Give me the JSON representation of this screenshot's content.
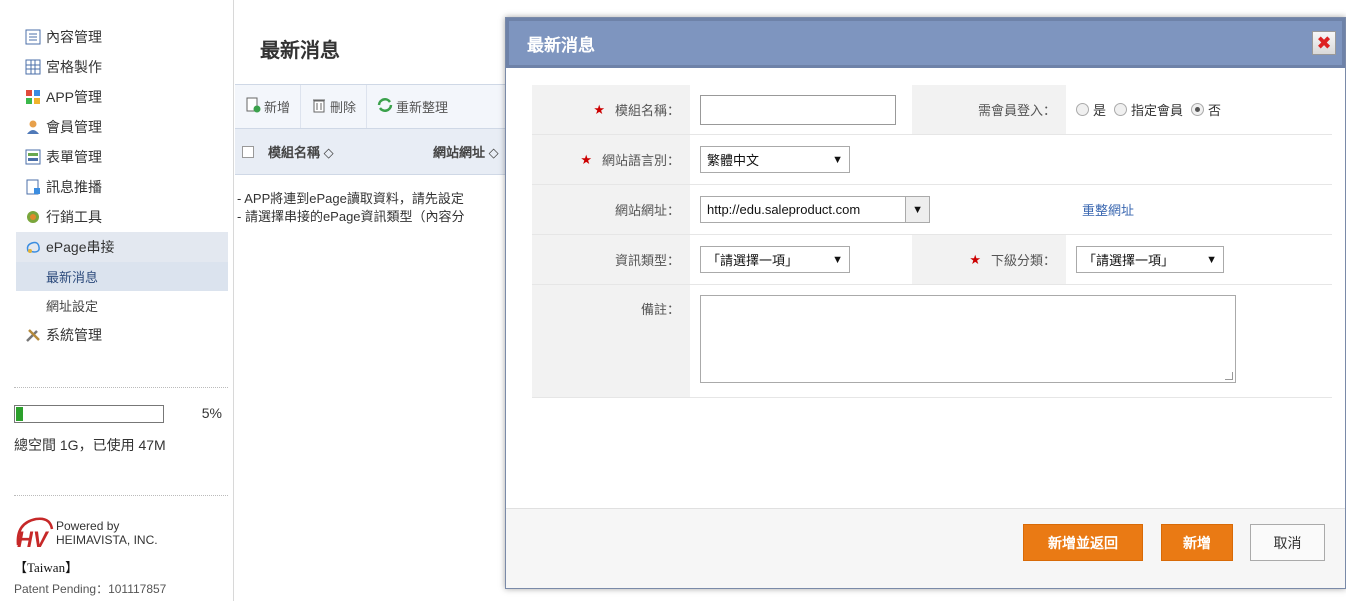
{
  "sidebar": {
    "items": [
      {
        "label": "內容管理",
        "icon": "list-icon"
      },
      {
        "label": "宮格製作",
        "icon": "grid-icon"
      },
      {
        "label": "APP管理",
        "icon": "app-icon"
      },
      {
        "label": "會員管理",
        "icon": "user-icon"
      },
      {
        "label": "表單管理",
        "icon": "form-icon"
      },
      {
        "label": "訊息推播",
        "icon": "message-icon"
      },
      {
        "label": "行銷工具",
        "icon": "marketing-icon"
      },
      {
        "label": "ePage串接",
        "icon": "epage-icon"
      },
      {
        "label": "系統管理",
        "icon": "tools-icon"
      }
    ],
    "sub_items": [
      "最新消息",
      "網址設定"
    ],
    "storage": {
      "percent": "5%",
      "used_fraction": 0.05,
      "text": "總空間 1G，已使用 47M"
    },
    "brand": {
      "line1": "Powered by",
      "line2": "HEIMAVISTA, INC.",
      "region": "【Taiwan】",
      "patent": "Patent Pending：101117857"
    }
  },
  "main": {
    "title": "最新消息",
    "toolbar": {
      "add": "新增",
      "delete": "刪除",
      "reorder": "重新整理"
    },
    "table": {
      "col1": "模組名稱 ◇",
      "col2": "網站網址 ◇"
    },
    "notes": [
      "- APP將連到ePage讀取資料，請先設定",
      "- 請選擇串接的ePage資訊類型（內容分"
    ]
  },
  "dialog": {
    "title": "最新消息",
    "close_glyph": "✖",
    "fields": {
      "module_name": {
        "label": "模組名稱：",
        "value": ""
      },
      "member_login": {
        "label": "需會員登入：",
        "options": [
          "是",
          "指定會員",
          "否"
        ],
        "selected": "否"
      },
      "language": {
        "label": "網站語言別：",
        "value": "繁體中文"
      },
      "site_url": {
        "label": "網站網址：",
        "value": "http://edu.saleproduct.com",
        "reset_link": "重整網址"
      },
      "info_type": {
        "label": "資訊類型：",
        "value": "「請選擇一項」"
      },
      "sub_category": {
        "label": "下級分類：",
        "value": "「請選擇一項」"
      },
      "remark": {
        "label": "備註：",
        "value": ""
      }
    },
    "buttons": {
      "add_return": "新增並返回",
      "add": "新增",
      "cancel": "取消"
    },
    "required_mark": "★",
    "arrow": "▼"
  }
}
